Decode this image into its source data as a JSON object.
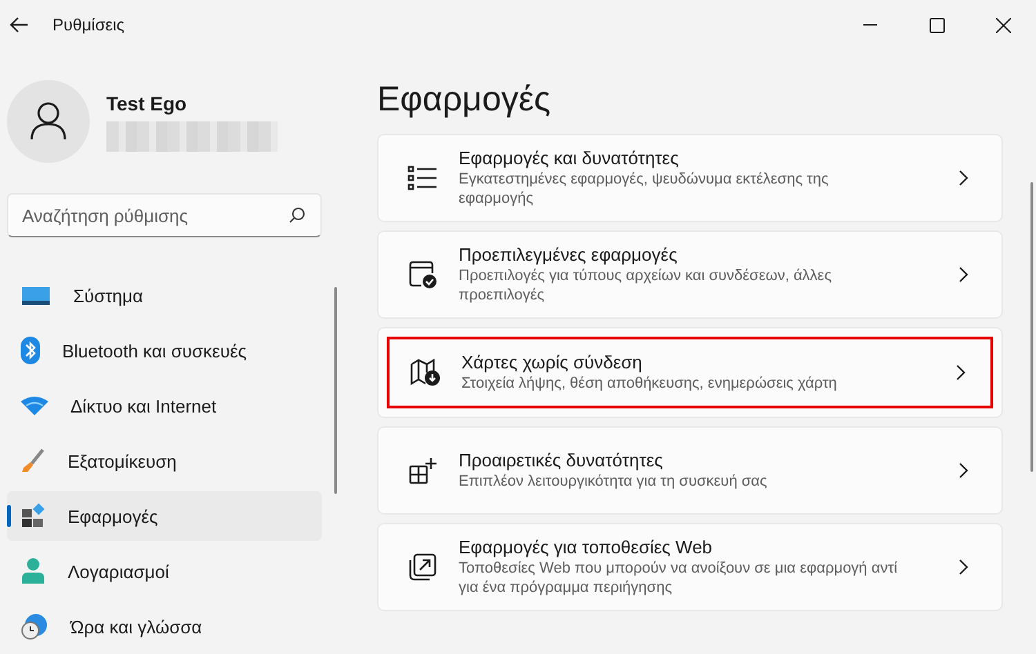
{
  "window": {
    "title": "Ρυθμίσεις"
  },
  "profile": {
    "name": "Test Ego"
  },
  "search": {
    "placeholder": "Αναζήτηση ρύθμισης"
  },
  "nav": [
    {
      "label": "Σύστημα",
      "kind": "system",
      "selected": false
    },
    {
      "label": "Bluetooth και συσκευές",
      "kind": "bluetooth",
      "selected": false
    },
    {
      "label": "Δίκτυο και Internet",
      "kind": "network",
      "selected": false
    },
    {
      "label": "Εξατομίκευση",
      "kind": "brush",
      "selected": false
    },
    {
      "label": "Εφαρμογές",
      "kind": "apps",
      "selected": true
    },
    {
      "label": "Λογαριασμοί",
      "kind": "account",
      "selected": false
    },
    {
      "label": "Ώρα και γλώσσα",
      "kind": "time",
      "selected": false
    }
  ],
  "page": {
    "title": "Εφαρμογές"
  },
  "cards": [
    {
      "title": "Εφαρμογές και δυνατότητες",
      "subtitle": "Εγκατεστημένες εφαρμογές, ψευδώνυμα εκτέλεσης της εφαρμογής",
      "kind": "list",
      "highlighted": false
    },
    {
      "title": "Προεπιλεγμένες εφαρμογές",
      "subtitle": "Προεπιλογές για τύπους αρχείων και συνδέσεων, άλλες προεπιλογές",
      "kind": "default",
      "highlighted": false
    },
    {
      "title": "Χάρτες χωρίς σύνδεση",
      "subtitle": "Στοιχεία λήψης, θέση αποθήκευσης, ενημερώσεις χάρτη",
      "kind": "map",
      "highlighted": true
    },
    {
      "title": "Προαιρετικές δυνατότητες",
      "subtitle": "Επιπλέον λειτουργικότητα για τη συσκευή σας",
      "kind": "optional",
      "highlighted": false
    },
    {
      "title": "Εφαρμογές για τοποθεσίες Web",
      "subtitle": "Τοποθεσίες Web που μπορούν να ανοίξουν σε μια εφαρμογή αντί για ένα πρόγραμμα περιήγησης",
      "kind": "web",
      "highlighted": false
    }
  ]
}
